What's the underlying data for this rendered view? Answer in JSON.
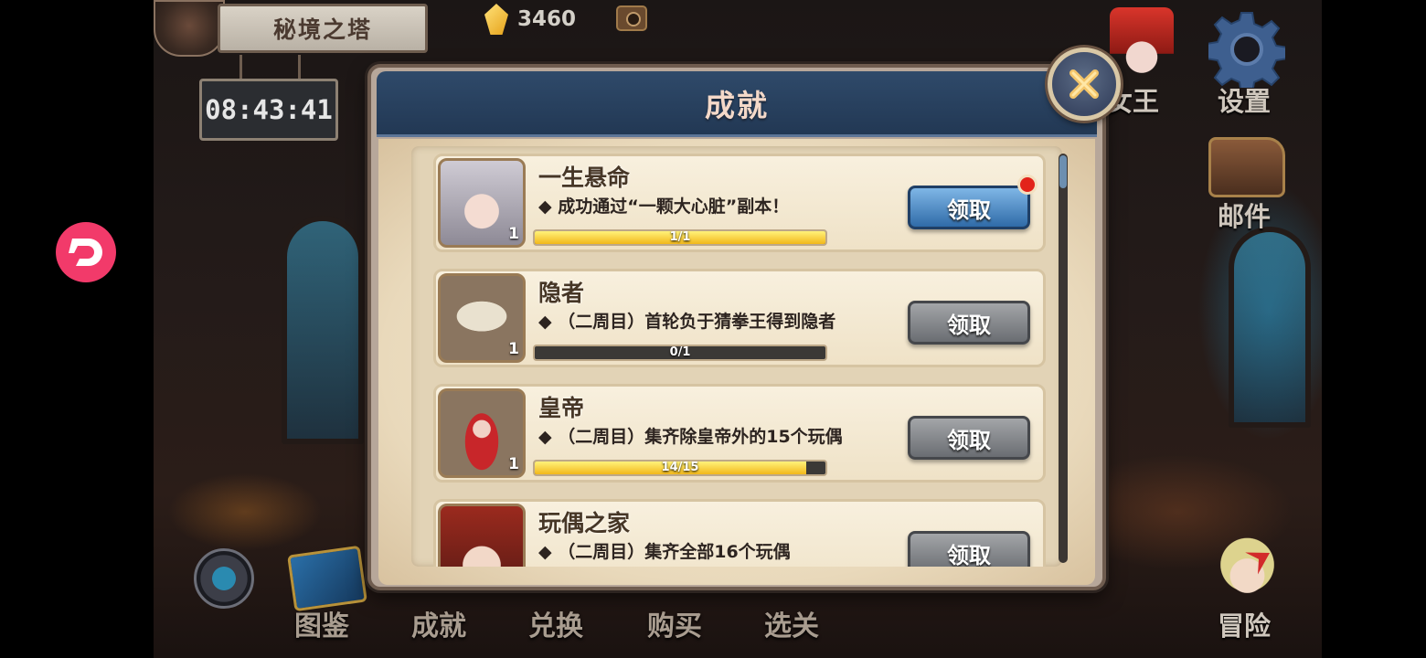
{
  "hud": {
    "location_title": "秘境之塔",
    "timer": "08:43:41",
    "gem_count": "3460"
  },
  "right_menu": {
    "queen_label": "女王",
    "settings_label": "设置",
    "mail_label": "邮件",
    "adventure_label": "冒险"
  },
  "bottom_nav": {
    "items": [
      {
        "label": "图鉴"
      },
      {
        "label": "成就"
      },
      {
        "label": "兑换"
      },
      {
        "label": "购买"
      },
      {
        "label": "选关"
      }
    ]
  },
  "dialog": {
    "title": "成就",
    "achievements": [
      {
        "name": "一生悬命",
        "description": "◆ 成功通过“一颗大心脏”副本！",
        "progress_text": "1/1",
        "progress": 1.0,
        "count": "1",
        "claim_label": "领取",
        "claimable": true,
        "notification": true
      },
      {
        "name": "隐者",
        "description": "◆ （二周目）首轮负于猜拳王得到隐者",
        "progress_text": "0/1",
        "progress": 0.0,
        "count": "1",
        "claim_label": "领取",
        "claimable": false
      },
      {
        "name": "皇帝",
        "description": "◆ （二周目）集齐除皇帝外的15个玩偶",
        "progress_text": "14/15",
        "progress": 0.933,
        "count": "1",
        "claim_label": "领取",
        "claimable": false
      },
      {
        "name": "玩偶之家",
        "description": "◆ （二周目）集齐全部16个玩偶",
        "claim_label": "领取",
        "claimable": false
      }
    ]
  },
  "colors": {
    "claim_active": "#2f6ba8",
    "claim_disabled": "#6a6d72",
    "progress_fill": "#f2b81a",
    "header_blue": "#223854",
    "float_badge": "#f23a6a"
  },
  "icons": [
    "close-icon",
    "gem-icon",
    "camera-icon",
    "gear-icon",
    "mail-icon",
    "float-app-icon"
  ]
}
